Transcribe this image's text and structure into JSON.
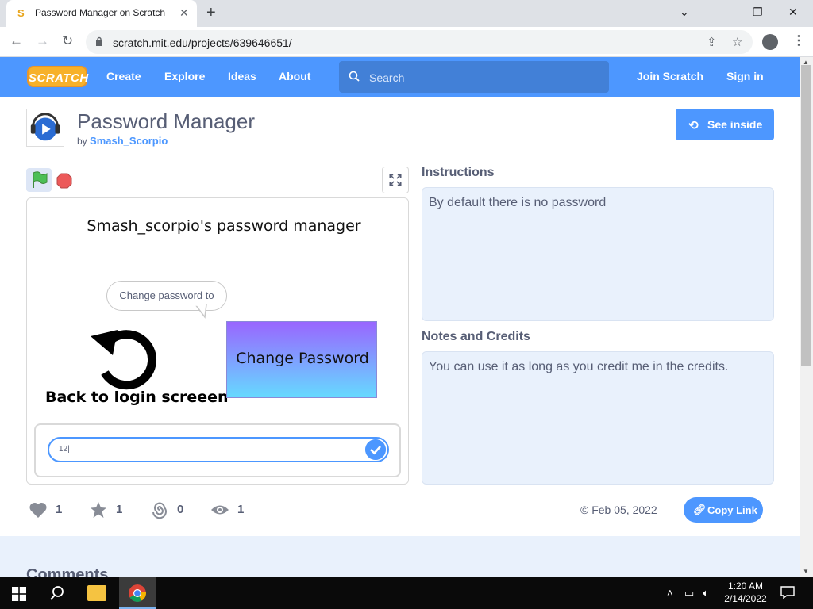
{
  "browser": {
    "tab_title": "Password Manager on Scratch",
    "tab_favicon": "S",
    "url": "scratch.mit.edu/projects/639646651/",
    "controls": {
      "close_tab": "✕",
      "new_tab": "+",
      "minimize": "—",
      "maximize": "❐",
      "close_window": "✕",
      "chevron": "⌄"
    }
  },
  "nav": {
    "logo": "SCRATCH",
    "links": [
      "Create",
      "Explore",
      "Ideas",
      "About"
    ],
    "search_placeholder": "Search",
    "join": "Join Scratch",
    "signin": "Sign in"
  },
  "project": {
    "title": "Password Manager",
    "by_prefix": "by",
    "author": "Smash_Scorpio",
    "see_inside": "See inside"
  },
  "stage": {
    "title": "Smash_scorpio's password manager",
    "bubble": "Change password to",
    "back_label": "Back to login screeen",
    "change_button": "Change Password",
    "ask_value": "12|"
  },
  "stats": {
    "loves": "1",
    "favorites": "1",
    "remixes": "0",
    "views": "1"
  },
  "instructions": {
    "heading": "Instructions",
    "text": "By default there is no password"
  },
  "notes": {
    "heading": "Notes and Credits",
    "text": "You can use it as long as you credit me in the credits."
  },
  "date": "© Feb 05, 2022",
  "copy_link": "Copy Link",
  "comments_heading": "Comments",
  "taskbar": {
    "time": "1:20 AM",
    "date": "2/14/2022"
  },
  "colors": {
    "scratch_blue": "#4d97ff",
    "accent": "#4c97ff",
    "panel": "#e9f1fc",
    "text": "#575e75"
  },
  "icons": [
    "lock-icon",
    "share-icon",
    "star-icon",
    "profile-icon",
    "menu-icon",
    "search-icon",
    "green-flag-icon",
    "stop-icon",
    "fullscreen-icon",
    "heart-icon",
    "favorite-star-icon",
    "remix-icon",
    "views-eye-icon",
    "link-icon",
    "windows-icon"
  ]
}
